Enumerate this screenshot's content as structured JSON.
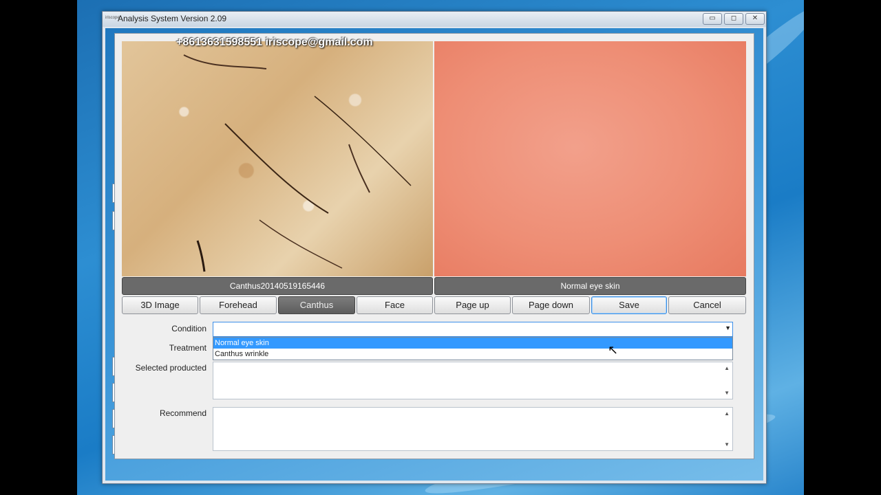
{
  "window": {
    "title": "Analysis System Version 2.09",
    "icon_text": "iriscope",
    "controls": {
      "minimize": "▭",
      "maximize": "◻",
      "close": "✕"
    }
  },
  "images": {
    "watermark": "+8613631598551   iriscope@gmail.com",
    "left_caption": "Canthus20140519165446",
    "right_caption": "Normal eye skin"
  },
  "toolbar": {
    "buttons": [
      "3D Image",
      "Forehead",
      "Canthus",
      "Face",
      "Page up",
      "Page down",
      "Save",
      "Cancel"
    ],
    "active": "Canthus"
  },
  "form": {
    "condition_label": "Condition",
    "condition_value": "",
    "condition_options": [
      "Normal eye skin",
      "Canthus wrinkle"
    ],
    "condition_highlighted": "Normal eye skin",
    "treatment_label": "Treatment",
    "selected_label": "Selected producted",
    "recommend_label": "Recommend"
  },
  "colors": {
    "accent": "#3399ff",
    "active_button": "#6a6a6a"
  },
  "icons": {
    "scroll_up": "▲",
    "scroll_down": "▼",
    "dropdown": "▼",
    "cursor": "↖"
  }
}
